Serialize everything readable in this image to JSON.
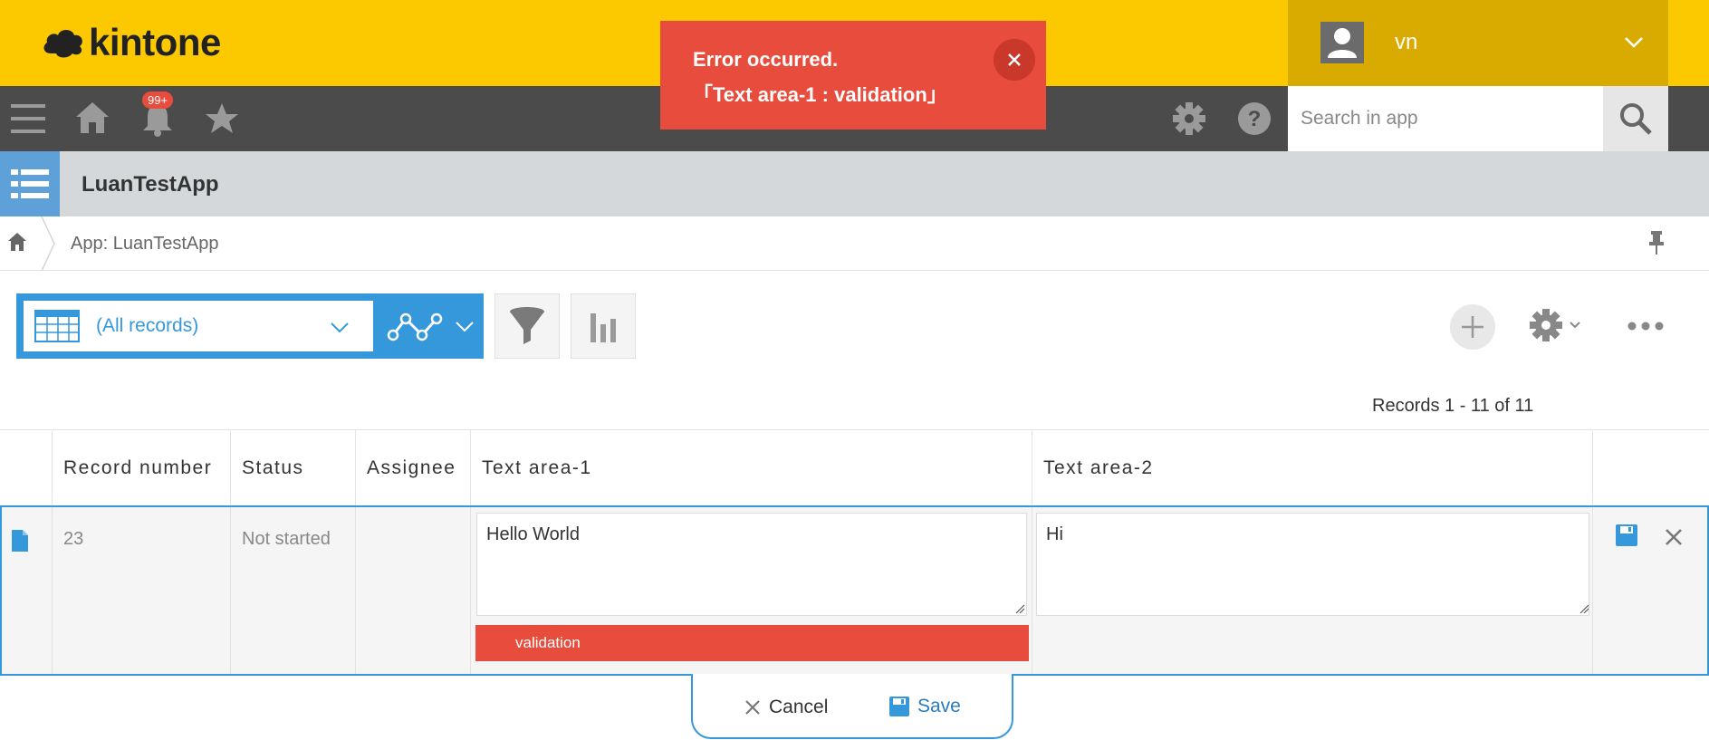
{
  "header": {
    "logo_text": "kintone",
    "user_name": "vn",
    "notification_badge": "99+",
    "search_placeholder": "Search in app"
  },
  "error_toast": {
    "line1": "Error occurred.",
    "line2": "「Text area-1 : validation」"
  },
  "app": {
    "title": "LuanTestApp",
    "breadcrumb": "App: LuanTestApp"
  },
  "toolbar": {
    "view_name": "(All records)",
    "records_count": "Records 1 - 11 of 11"
  },
  "table": {
    "columns": [
      "Record number",
      "Status",
      "Assignee",
      "Text area-1",
      "Text area-2"
    ],
    "row": {
      "record_number": "23",
      "status": "Not started",
      "assignee": "",
      "text_area_1": "Hello World",
      "text_area_2": "Hi",
      "validation_message": "validation"
    }
  },
  "actions": {
    "cancel_label": "Cancel",
    "save_label": "Save"
  },
  "colors": {
    "header_yellow": "#fcc800",
    "error_red": "#e74c3c",
    "accent_blue": "#3498db",
    "nav_gray": "#4b4b4b"
  }
}
